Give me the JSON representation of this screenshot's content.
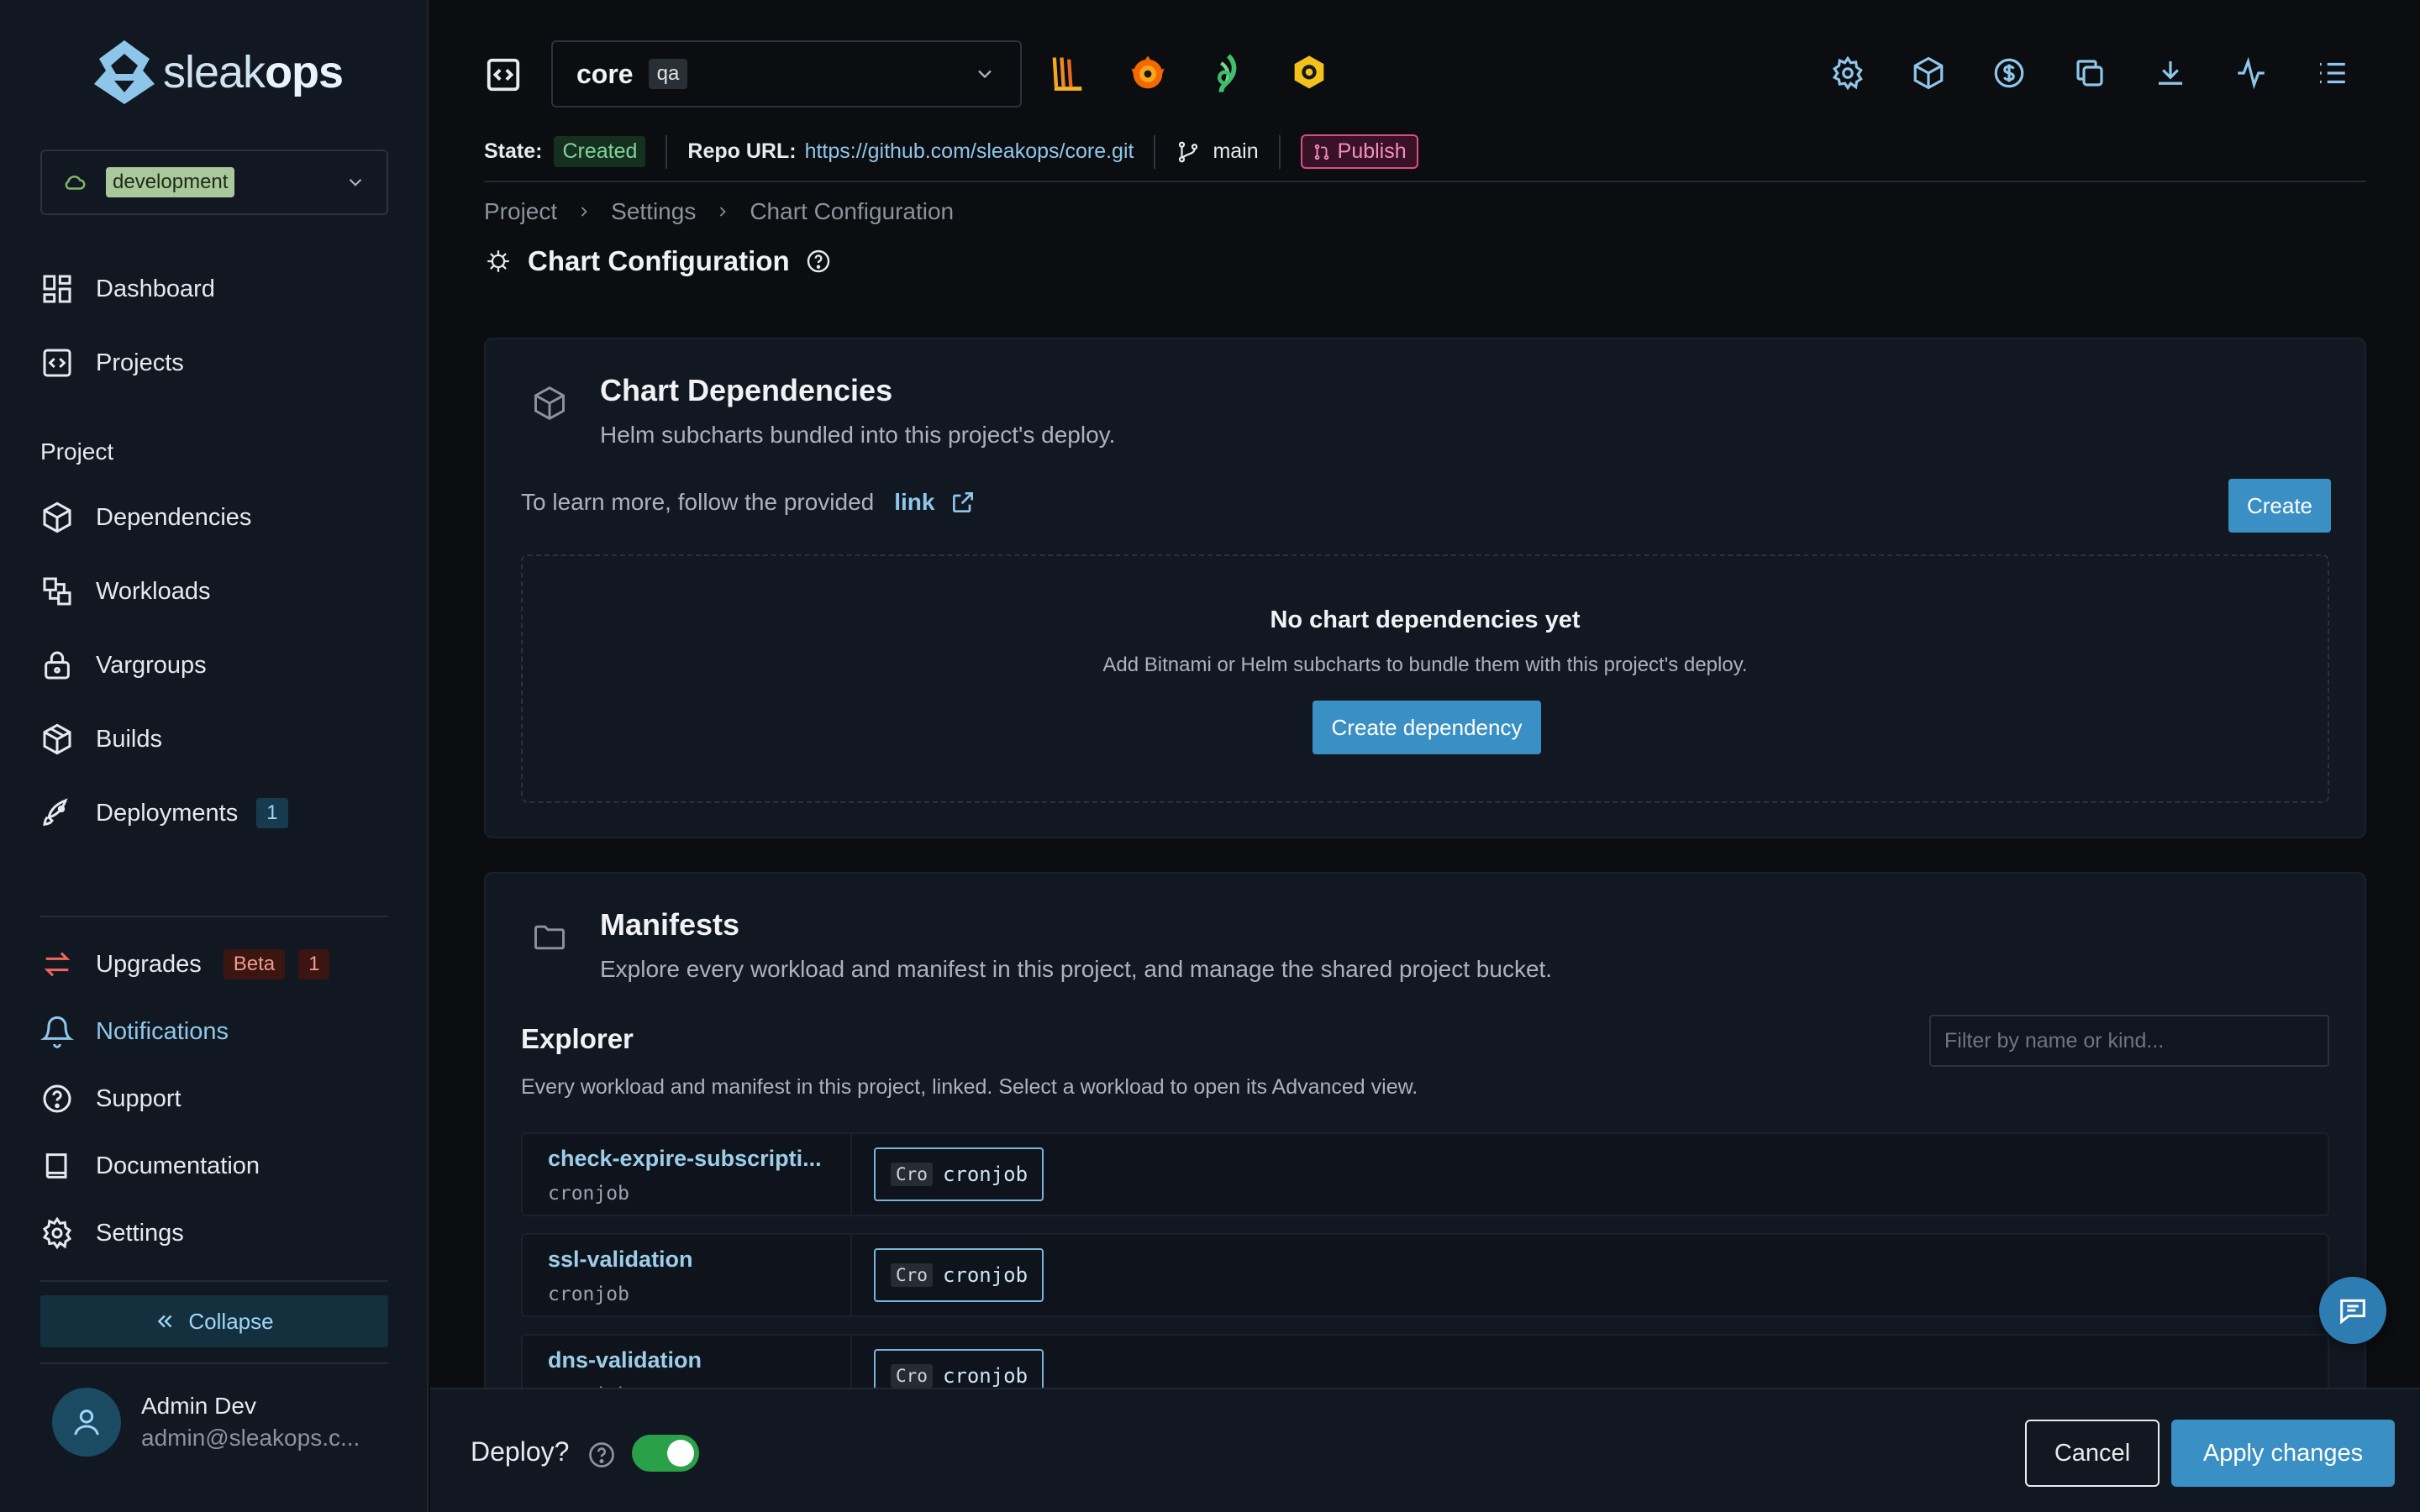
{
  "brand": {
    "logo_light": "sleak",
    "logo_bold": "ops"
  },
  "environment": {
    "selected": "development"
  },
  "sidebar": {
    "main_items": [
      {
        "label": "Dashboard",
        "icon": "dashboard-icon"
      },
      {
        "label": "Projects",
        "icon": "code-box-icon"
      }
    ],
    "section_label": "Project",
    "project_items": [
      {
        "label": "Dependencies",
        "icon": "cube-icon"
      },
      {
        "label": "Workloads",
        "icon": "shapes-icon"
      },
      {
        "label": "Vargroups",
        "icon": "lock-icon"
      },
      {
        "label": "Builds",
        "icon": "package-icon"
      },
      {
        "label": "Deployments",
        "icon": "rocket-icon",
        "badge": "1"
      }
    ],
    "bottom_items": [
      {
        "label": "Upgrades",
        "icon": "arrows-icon",
        "beta": "Beta",
        "badge": "1"
      },
      {
        "label": "Notifications",
        "icon": "bell-icon"
      },
      {
        "label": "Support",
        "icon": "help-circle-icon"
      },
      {
        "label": "Documentation",
        "icon": "book-icon"
      },
      {
        "label": "Settings",
        "icon": "gear-icon"
      }
    ],
    "collapse_label": "Collapse",
    "user": {
      "name": "Admin Dev",
      "email": "admin@sleakops.c..."
    }
  },
  "topbar": {
    "project": {
      "name": "core",
      "env": "qa"
    },
    "tool_icons": [
      "loki-icon",
      "grafana-icon",
      "otel-icon",
      "prometheus-icon"
    ],
    "right_icons": [
      "gear-icon",
      "box-icon",
      "dollar-icon",
      "copy-icon",
      "download-icon",
      "activity-icon",
      "list-icon"
    ],
    "state_label": "State:",
    "state_value": "Created",
    "repo_label": "Repo URL:",
    "repo_url": "https://github.com/sleakops/core.git",
    "branch": "main",
    "publish_label": "Publish"
  },
  "breadcrumb": [
    "Project",
    "Settings",
    "Chart Configuration"
  ],
  "page_title": "Chart Configuration",
  "chart_dependencies": {
    "title": "Chart Dependencies",
    "subtitle": "Helm subcharts bundled into this project's deploy.",
    "learn_text": "To learn more, follow the provided",
    "learn_link": "link",
    "create_label": "Create",
    "empty_title": "No chart dependencies yet",
    "empty_subtitle": "Add Bitnami or Helm subcharts to bundle them with this project's deploy.",
    "create_dependency_label": "Create dependency"
  },
  "manifests": {
    "title": "Manifests",
    "subtitle": "Explore every workload and manifest in this project, and manage the shared project bucket.",
    "explorer_title": "Explorer",
    "explorer_subtitle": "Every workload and manifest in this project, linked. Select a workload to open its Advanced view.",
    "filter_placeholder": "Filter by name or kind...",
    "rows": [
      {
        "name": "check-expire-subscripti...",
        "kind": "cronjob",
        "tag": "Cro",
        "chip": "cronjob"
      },
      {
        "name": "ssl-validation",
        "kind": "cronjob",
        "tag": "Cro",
        "chip": "cronjob"
      },
      {
        "name": "dns-validation",
        "kind": "cronjob",
        "tag": "Cro",
        "chip": "cronjob"
      }
    ]
  },
  "footer": {
    "deploy_label": "Deploy?",
    "deploy_enabled": true,
    "cancel_label": "Cancel",
    "apply_label": "Apply changes"
  },
  "colors": {
    "accent": "#3a8fc4",
    "link": "#8fc7ec",
    "success": "#7fd39a",
    "publish": "#d84d8a",
    "toggle_on": "#2aa048"
  }
}
